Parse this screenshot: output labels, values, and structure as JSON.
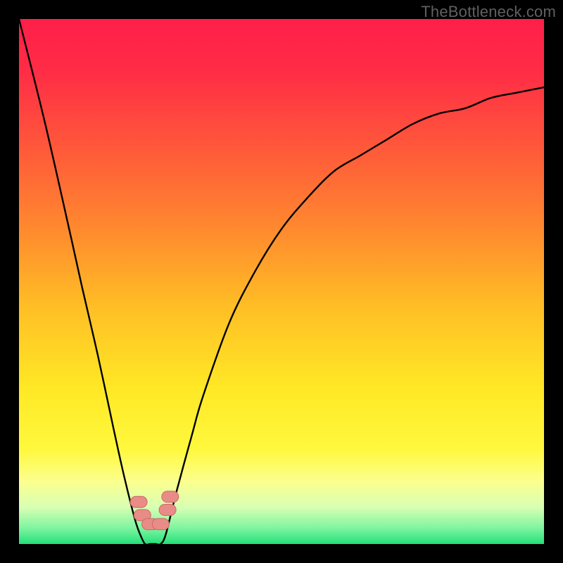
{
  "watermark": "TheBottleneck.com",
  "chart_data": {
    "type": "line",
    "title": "",
    "xlabel": "",
    "ylabel": "",
    "xlim": [
      0,
      100
    ],
    "ylim": [
      0,
      100
    ],
    "series": [
      {
        "name": "bottleneck-curve",
        "x": [
          0,
          5,
          10,
          12,
          15,
          18,
          20,
          22,
          23,
          24,
          25,
          26,
          27,
          28,
          30,
          33,
          35,
          40,
          45,
          50,
          55,
          60,
          65,
          70,
          75,
          80,
          85,
          90,
          95,
          100
        ],
        "values": [
          100,
          80,
          58,
          49,
          36,
          22,
          13,
          5,
          2,
          0,
          0,
          0,
          0,
          2,
          10,
          21,
          28,
          42,
          52,
          60,
          66,
          71,
          74,
          77,
          80,
          82,
          83,
          85,
          86,
          87
        ]
      }
    ],
    "markers": [
      {
        "x_pct": 22.8,
        "y_pct_from_top": 92.0,
        "label": "marker-left-upper"
      },
      {
        "x_pct": 23.5,
        "y_pct_from_top": 94.5,
        "label": "marker-left-lower"
      },
      {
        "x_pct": 25.0,
        "y_pct_from_top": 96.2,
        "label": "marker-bottom-left"
      },
      {
        "x_pct": 27.0,
        "y_pct_from_top": 96.2,
        "label": "marker-bottom-right"
      },
      {
        "x_pct": 28.3,
        "y_pct_from_top": 93.5,
        "label": "marker-right-lower"
      },
      {
        "x_pct": 28.8,
        "y_pct_from_top": 91.0,
        "label": "marker-right-upper"
      }
    ],
    "gradient_stops": [
      {
        "offset": 0.0,
        "color": "#ff1f4a"
      },
      {
        "offset": 0.1,
        "color": "#ff2d46"
      },
      {
        "offset": 0.25,
        "color": "#ff5a3a"
      },
      {
        "offset": 0.4,
        "color": "#ff8a2f"
      },
      {
        "offset": 0.55,
        "color": "#ffbf25"
      },
      {
        "offset": 0.7,
        "color": "#ffe825"
      },
      {
        "offset": 0.82,
        "color": "#fff93e"
      },
      {
        "offset": 0.88,
        "color": "#fcff8e"
      },
      {
        "offset": 0.93,
        "color": "#d9ffb4"
      },
      {
        "offset": 0.97,
        "color": "#7ef5a0"
      },
      {
        "offset": 1.0,
        "color": "#24e07a"
      }
    ],
    "marker_fill": "#e98b86",
    "marker_stroke": "#c96b66",
    "curve_stroke": "#000000"
  }
}
